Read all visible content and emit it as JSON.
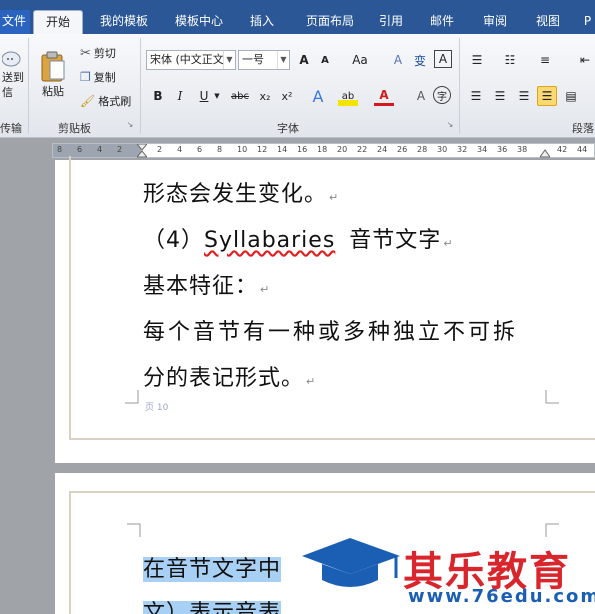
{
  "tabs": {
    "file": "文件",
    "items": [
      "开始",
      "我的模板",
      "模板中心",
      "插入",
      "页面布局",
      "引用",
      "邮件",
      "审阅",
      "视图",
      "P"
    ]
  },
  "ribbon": {
    "transfer_label": "送到\n信",
    "transfer_group": "传输",
    "paste_label": "粘贴",
    "cut_label": "剪切",
    "copy_label": "复制",
    "format_painter_label": "格式刷",
    "clipboard_group": "剪贴板",
    "font_name": "宋体 (中文正文",
    "font_size": "一号",
    "font_group": "字体",
    "paragraph_group": "段落",
    "font_buttons": [
      "A",
      "A",
      "Aa",
      "A",
      "变",
      "A"
    ],
    "format_buttons": [
      "B",
      "I",
      "U",
      "abc",
      "x₂",
      "x²",
      "A",
      "ab",
      "A",
      "A",
      "字"
    ]
  },
  "ruler": {
    "ticks": [
      "8",
      "6",
      "4",
      "2",
      "",
      "2",
      "4",
      "6",
      "8",
      "10",
      "12",
      "14",
      "16",
      "18",
      "20",
      "22",
      "24",
      "26",
      "28",
      "30",
      "32",
      "34",
      "36",
      "38",
      "",
      "42",
      "44"
    ]
  },
  "page1": {
    "lines": [
      "形态会发生变化。",
      "（4）",
      "Syllabaries",
      "音节文字",
      "基本特征：",
      "每个音节有一种或多种独立不可拆",
      "分的表记形式。"
    ],
    "footer": "页 10"
  },
  "page2": {
    "line1": "在音节文字中",
    "line2": "文）表示音表"
  },
  "watermark": {
    "title": "其乐教育",
    "url": "www.76edu.com"
  }
}
